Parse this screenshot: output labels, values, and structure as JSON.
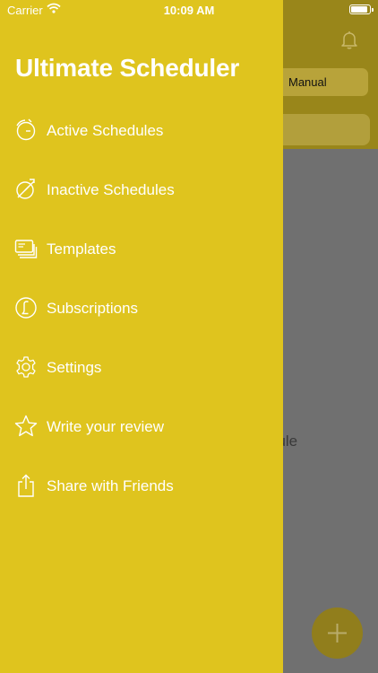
{
  "status_bar": {
    "carrier": "Carrier",
    "time": "10:09 AM",
    "battery_level": 0.9
  },
  "drawer": {
    "title": "Ultimate Scheduler",
    "items": [
      {
        "label": "Active Schedules",
        "icon": "active-schedules-icon"
      },
      {
        "label": "Inactive Schedules",
        "icon": "inactive-schedules-icon"
      },
      {
        "label": "Templates",
        "icon": "templates-icon"
      },
      {
        "label": "Subscriptions",
        "icon": "subscriptions-icon"
      },
      {
        "label": "Settings",
        "icon": "gear-icon"
      },
      {
        "label": "Write your review",
        "icon": "star-icon"
      },
      {
        "label": "Share with Friends",
        "icon": "share-icon"
      }
    ]
  },
  "background": {
    "segment_label": "Manual",
    "empty_text": "dule",
    "fab_icon": "plus-icon"
  },
  "colors": {
    "drawer": "#dfc41e",
    "header_dimmed": "#99861a",
    "body_dimmed": "#707070"
  }
}
